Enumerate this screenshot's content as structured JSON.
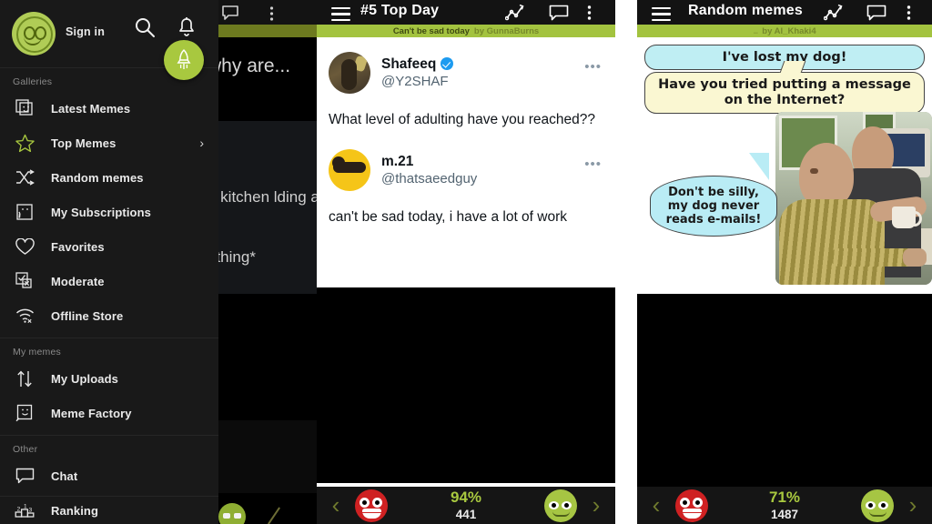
{
  "app": {
    "accent_green": "#a8c83f",
    "bar_green": "#a3c33f",
    "dark_bg": "#191919",
    "topbar_bg": "#131313"
  },
  "panel1": {
    "drawer": {
      "logo_icon": "green-smiley-logo",
      "sign_in": "Sign in",
      "search_icon": "search-icon",
      "bell_icon": "notification-bell-icon",
      "fab_icon": "rocket-icon",
      "sections": [
        {
          "label": "Galleries",
          "items": [
            {
              "label": "Latest Memes",
              "icon": "stacked-photos-smiley-icon",
              "chevron": ""
            },
            {
              "label": "Top Memes",
              "icon": "star-icon",
              "chevron": "›"
            },
            {
              "label": "Random memes",
              "icon": "shuffle-icon",
              "chevron": ""
            },
            {
              "label": "My Subscriptions",
              "icon": "rss-photo-icon",
              "chevron": ""
            },
            {
              "label": "Favorites",
              "icon": "heart-icon",
              "chevron": ""
            },
            {
              "label": "Moderate",
              "icon": "checkbox-x-icon",
              "chevron": ""
            },
            {
              "label": "Offline Store",
              "icon": "wifi-off-icon",
              "chevron": ""
            }
          ]
        },
        {
          "label": "My memes",
          "items": [
            {
              "label": "My Uploads",
              "icon": "up-down-arrows-icon",
              "chevron": ""
            },
            {
              "label": "Meme Factory",
              "icon": "photo-edit-icon",
              "chevron": ""
            }
          ]
        },
        {
          "label": "Other",
          "items": [
            {
              "label": "Chat",
              "icon": "chat-bubble-icon",
              "chevron": ""
            },
            {
              "label": "Ranking",
              "icon": "podium-icon",
              "chevron": ""
            }
          ]
        }
      ]
    },
    "background": {
      "chat_icon": "chat-bubble-icon",
      "overflow_icon": "overflow-menu-icon",
      "title_fragment": "ds why are...",
      "text_fragment_1": "e kitchen lding a",
      "text_fragment_2": "uthing*"
    }
  },
  "panel2": {
    "header": {
      "menu_icon": "hamburger-menu-icon",
      "title": "#5 Top Day",
      "trend_icon": "trend-chart-icon",
      "chat_icon": "chat-bubble-icon",
      "overflow_icon": "overflow-menu-icon"
    },
    "credit": {
      "title": "Can't be sad today",
      "by": "by GunnaBurns"
    },
    "tweets": [
      {
        "name": "Shafeeq",
        "verified": true,
        "handle": "@Y2SHAF",
        "text": "What level of adulting have you reached??",
        "more_icon": "overflow-menu-icon"
      },
      {
        "name": "m.21",
        "verified": false,
        "handle": "@thatsaeedguy",
        "text": "can't be sad today, i have a lot of work",
        "more_icon": "overflow-menu-icon"
      }
    ],
    "bottom": {
      "prev_icon": "chevron-left-icon",
      "next_icon": "chevron-right-icon",
      "downvote_icon": "red-rage-face-icon",
      "upvote_icon": "green-rage-face-icon",
      "percent": "94%",
      "count": "441"
    }
  },
  "panel3": {
    "header": {
      "menu_icon": "hamburger-menu-icon",
      "title": "Random memes",
      "trend_icon": "trend-chart-icon",
      "chat_icon": "chat-bubble-icon",
      "overflow_icon": "overflow-menu-icon"
    },
    "credit": {
      "dots": "...",
      "by": "by Al_Khaki4"
    },
    "meme": {
      "bubble1": "I've lost my dog!",
      "bubble2": "Have you tried putting a message on the Internet?",
      "bubble3": "Don't be silly, my dog never reads e-mails!",
      "photo_alt": "two-men-at-computer-photo"
    },
    "bottom": {
      "prev_icon": "chevron-left-icon",
      "next_icon": "chevron-right-icon",
      "downvote_icon": "red-rage-face-icon",
      "upvote_icon": "green-rage-face-icon",
      "percent": "71%",
      "count": "1487"
    }
  }
}
